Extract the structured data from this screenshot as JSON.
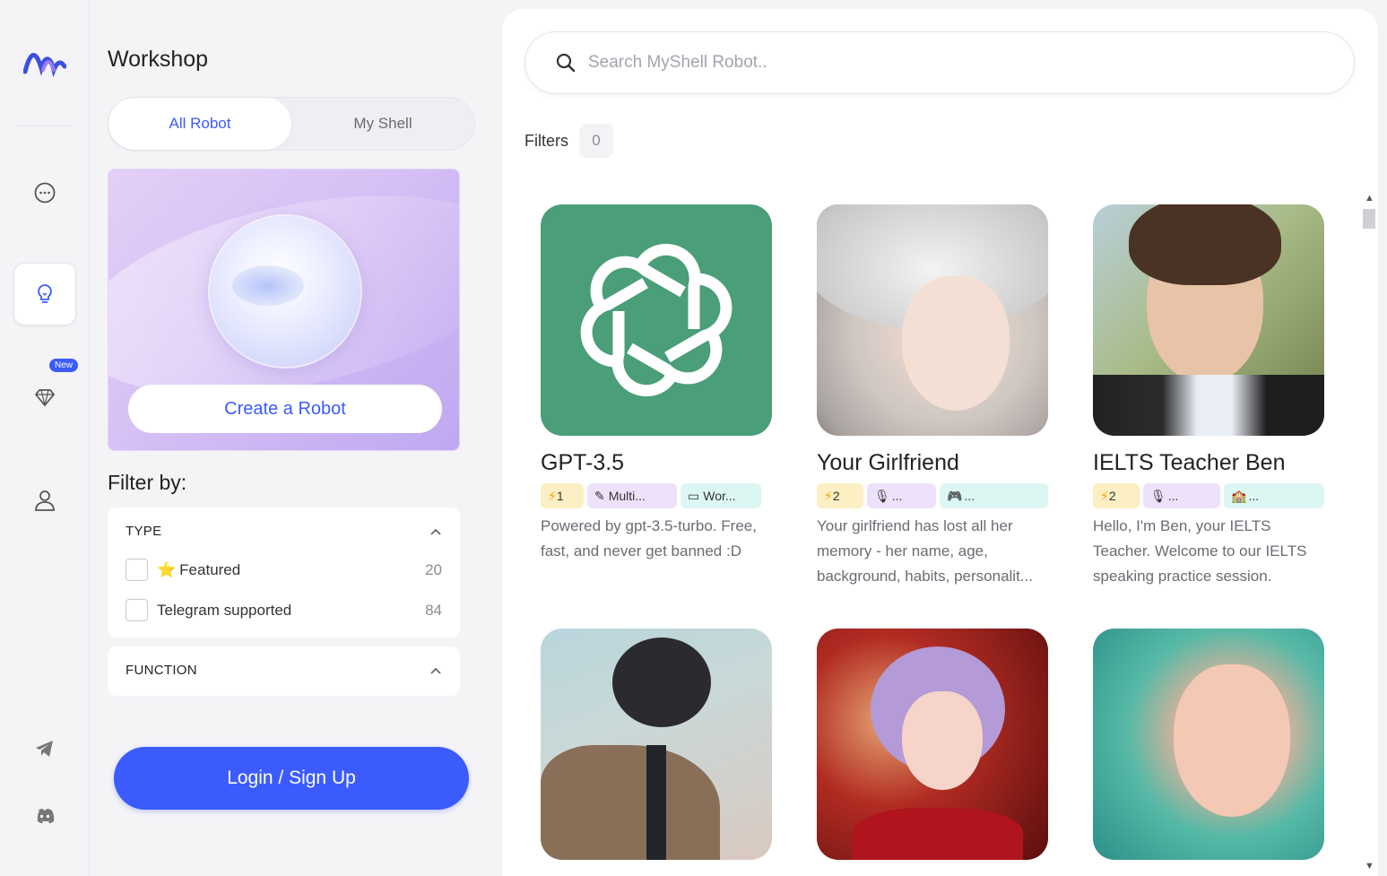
{
  "sidebar": {
    "title": "Workshop",
    "tabs": [
      {
        "label": "All Robot"
      },
      {
        "label": "My Shell"
      }
    ],
    "hero": {
      "button": "Create a Robot"
    },
    "filter_title": "Filter by:",
    "groups": [
      {
        "title": "TYPE",
        "options": [
          {
            "label": "Featured",
            "count": "20"
          },
          {
            "label": "Telegram supported",
            "count": "84"
          }
        ]
      },
      {
        "title": "FUNCTION"
      }
    ],
    "login": "Login / Sign Up"
  },
  "rail": {
    "new_badge": "New"
  },
  "main": {
    "search_placeholder": "Search MyShell Robot..",
    "filters_label": "Filters",
    "filters_count": "0",
    "bots": [
      {
        "name": "GPT-3.5",
        "tags": [
          "1",
          "Multi...",
          "Wor..."
        ],
        "desc": "Powered by gpt-3.5-turbo.  Free, fast, and never get banned :D"
      },
      {
        "name": "Your Girlfriend",
        "tags": [
          "2",
          "...",
          "..."
        ],
        "desc": "Your girlfriend has lost all her memory - her name, age, background, habits, personalit..."
      },
      {
        "name": "IELTS Teacher Ben",
        "tags": [
          "2",
          "...",
          "..."
        ],
        "desc": "Hello, I'm Ben, your IELTS Teacher. Welcome to our IELTS speaking practice session."
      }
    ]
  },
  "colors": {
    "accent": "#3b5bfd",
    "gpt_green": "#4a9e78"
  }
}
